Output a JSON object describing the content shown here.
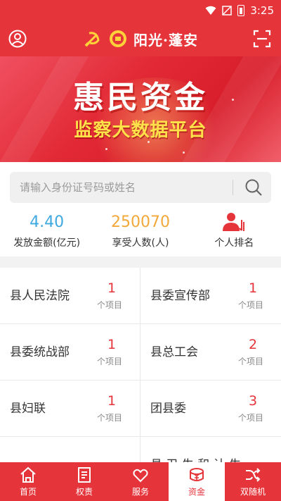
{
  "status_bar": {
    "time": "3:25"
  },
  "header": {
    "title": "阳光·蓬安",
    "left_icon": "user-icon",
    "right_icon": "scan-icon"
  },
  "banner": {
    "title": "惠民资金",
    "subtitle": "监察大数据平台"
  },
  "search": {
    "placeholder": "请输入身份证号码或姓名"
  },
  "stats": [
    {
      "value": "4.40",
      "label": "发放金额(亿元)",
      "color": "#3fa9e0"
    },
    {
      "value": "250070",
      "label": "享受人数(人)",
      "color": "#f3a83a"
    },
    {
      "label": "个人排名",
      "icon": "ranking-icon",
      "color": "#e5343a"
    }
  ],
  "departments": [
    {
      "name": "县人民法院",
      "count": "1",
      "unit": "个项目"
    },
    {
      "name": "县委宣传部",
      "count": "1",
      "unit": "个项目"
    },
    {
      "name": "县委统战部",
      "count": "1",
      "unit": "个项目"
    },
    {
      "name": "县总工会",
      "count": "2",
      "unit": "个项目"
    },
    {
      "name": "县妇联",
      "count": "1",
      "unit": "个项目"
    },
    {
      "name": "团县委",
      "count": "3",
      "unit": "个项目"
    },
    {
      "name": "",
      "count": "",
      "unit": ""
    },
    {
      "name": "县 卫 生 和 计 生",
      "count": "",
      "unit": ""
    }
  ],
  "tabs": [
    {
      "label": "首页",
      "icon": "home-icon",
      "active": false
    },
    {
      "label": "权责",
      "icon": "document-icon",
      "active": false
    },
    {
      "label": "服务",
      "icon": "handshake-icon",
      "active": false
    },
    {
      "label": "资金",
      "icon": "money-icon",
      "active": true
    },
    {
      "label": "双随机",
      "icon": "shuffle-icon",
      "active": false
    }
  ],
  "colors": {
    "primary": "#e5343a",
    "accent_yellow": "#ffe24a",
    "blue": "#3fa9e0",
    "orange": "#f3a83a"
  }
}
